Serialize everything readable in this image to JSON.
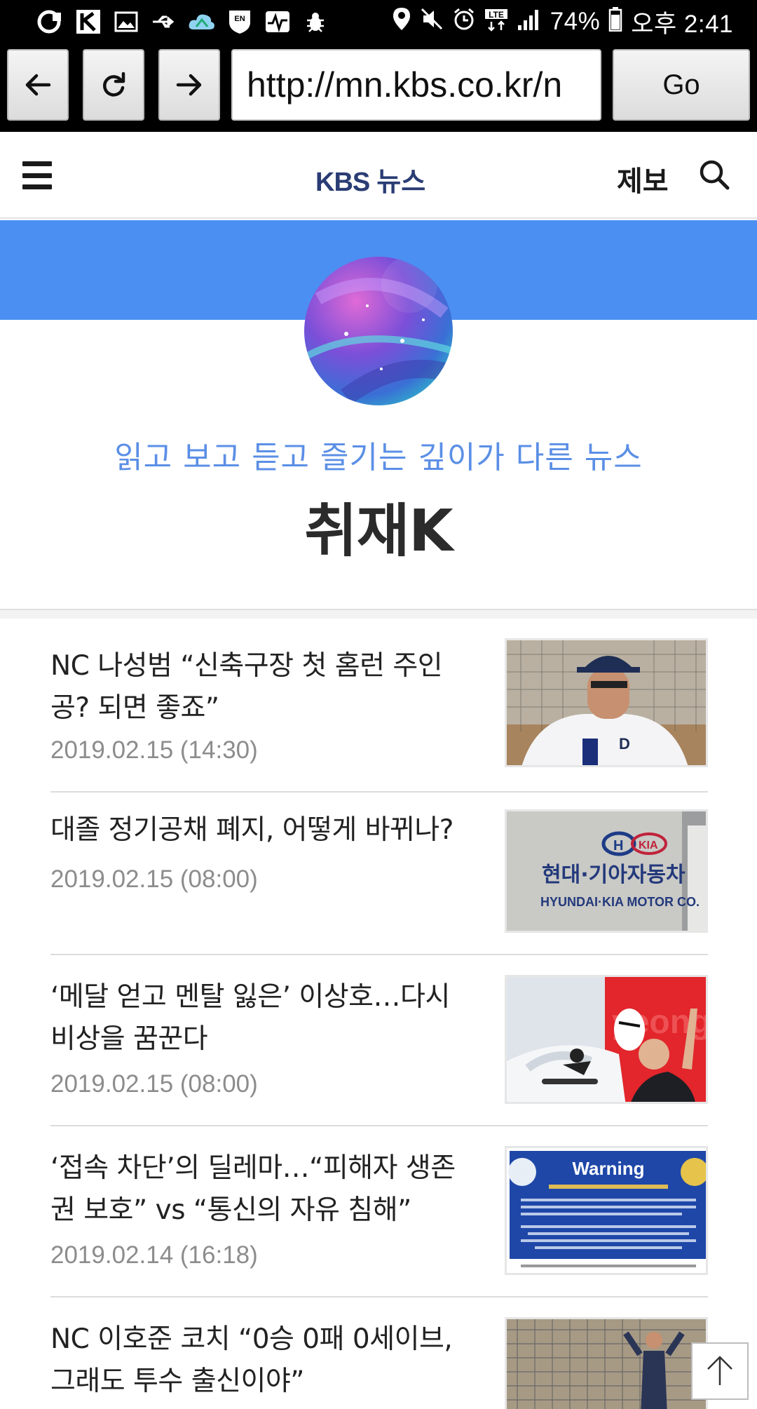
{
  "status_bar": {
    "battery": "74%",
    "time": "오후 2:41",
    "left_icons": [
      "u-plus-icon",
      "k-app-icon",
      "gallery-icon",
      "usb-icon",
      "cloud-icon",
      "en-shield-icon",
      "pulse-icon",
      "bug-icon"
    ],
    "right_icons": [
      "location-icon",
      "mute-icon",
      "alarm-icon",
      "lte-icon",
      "signal-icon",
      "battery-icon"
    ]
  },
  "browser": {
    "url": "http://mn.kbs.co.kr/n",
    "go_label": "Go"
  },
  "header": {
    "logo_kbs": "KBS",
    "logo_news": "뉴스",
    "tip_label": "제보"
  },
  "hero": {
    "tagline": "읽고 보고 듣고 즐기는 깊이가 다른 뉴스",
    "program_title": "취재K",
    "band_color": "#4b8ff2"
  },
  "articles": [
    {
      "title": "NC 나성범 “신축구장 첫 홈런 주인공? 되면 좋죠”",
      "date": "2019.02.15 (14:30)",
      "thumb": "baseball-player-interview"
    },
    {
      "title": "대졸 정기공채 폐지, 어떻게 바뀌나?",
      "date": "2019.02.15 (08:00)",
      "thumb": "hyundai-kia-building"
    },
    {
      "title": "‘메달 얻고 멘탈 잃은’ 이상호…다시 비상을 꿈꾼다",
      "date": "2019.02.15 (08:00)",
      "thumb": "snowboarder"
    },
    {
      "title": "‘접속 차단’의 딜레마…“피해자 생존권 보호” vs “통신의 자유 침해”",
      "date": "2019.02.14 (16:18)",
      "thumb": "warning-page"
    },
    {
      "title": "NC 이호준 코치 “0승 0패 0세이브, 그래도 투수 출신이야”",
      "date": "",
      "thumb": "baseball-coach"
    }
  ],
  "warning_thumb_text": "Warning"
}
